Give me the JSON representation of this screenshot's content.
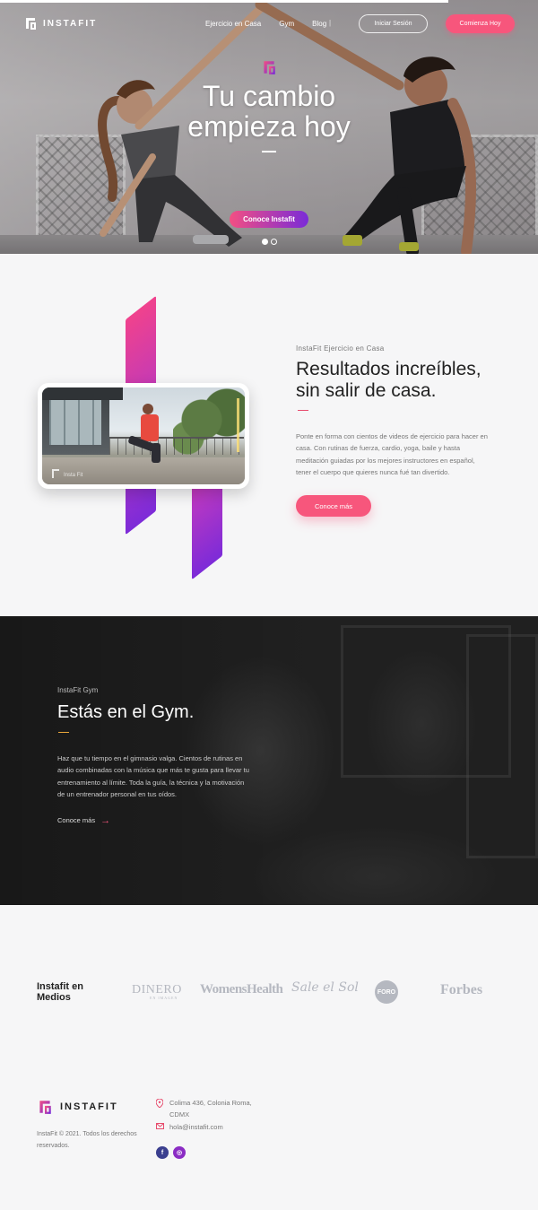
{
  "nav": {
    "logo_text": "INSTAFIT",
    "links": [
      "Ejercicio en Casa",
      "Gym",
      "Blog"
    ],
    "separator": "|",
    "login_label": "Iniciar Sesión",
    "start_label": "Comienza Hoy"
  },
  "hero": {
    "title_line1": "Tu cambio",
    "title_line2": "empieza hoy",
    "cta_label": "Conoce Instafit",
    "slides_total": 2,
    "slide_active": 1
  },
  "home": {
    "eyebrow": "InstaFit Ejercicio en Casa",
    "title_line1": "Resultados increíbles,",
    "title_line2": "sin salir de casa.",
    "body_lines": [
      "Ponte en forma con cientos de videos de ejercicio para hacer en",
      "casa. Con rutinas de fuerza, cardio, yoga, baile y hasta",
      "meditación guiadas por los mejores instructores en español,",
      "tener el cuerpo que quieres nunca fué tan divertido."
    ],
    "cta_label": "Conoce más",
    "video_badge": "Insta Fit"
  },
  "gym": {
    "eyebrow": "InstaFit Gym",
    "title": "Estás en el Gym.",
    "body_lines": [
      "Haz que tu tiempo en el gimnasio valga. Cientos de rutinas en",
      "audio combinadas con la música que más te gusta para llevar tu",
      "entrenamiento al límite. Toda la guía, la técnica y la motivación",
      "de un entrenador personal en tus oídos."
    ],
    "link_label": "Conoce más",
    "link_arrow": "→"
  },
  "press": {
    "title_line1": "Instafit en",
    "title_line2": "Medios",
    "logos": {
      "dinero": "DINERO",
      "dinero_sub": "EN IMAGEN",
      "womens_health": "WomensHealth",
      "sal_sol": "Sale el Sol",
      "foro": "FORO",
      "forbes": "Forbes"
    }
  },
  "footer": {
    "logo_text": "INSTAFIT",
    "copyright_line1": "InstaFit © 2021. Todos los derechos",
    "copyright_line2": "reservados.",
    "address_line1": "Colima 436, Colonia Roma,",
    "address_line2": "CDMX",
    "email": "hola@instafit.com",
    "social": {
      "facebook": "f",
      "instagram": "◎"
    }
  },
  "colors": {
    "accent_pink": "#f7567c",
    "gradient_start": "#f34f83",
    "gradient_end": "#7a2bd7",
    "gym_dash": "#e9a73b",
    "dark_bg": "#202020",
    "light_bg": "#f6f6f7"
  },
  "icons": [
    "logo-mark-icon",
    "map-pin-icon",
    "mail-icon",
    "facebook-icon",
    "instagram-icon",
    "arrow-right-icon"
  ]
}
